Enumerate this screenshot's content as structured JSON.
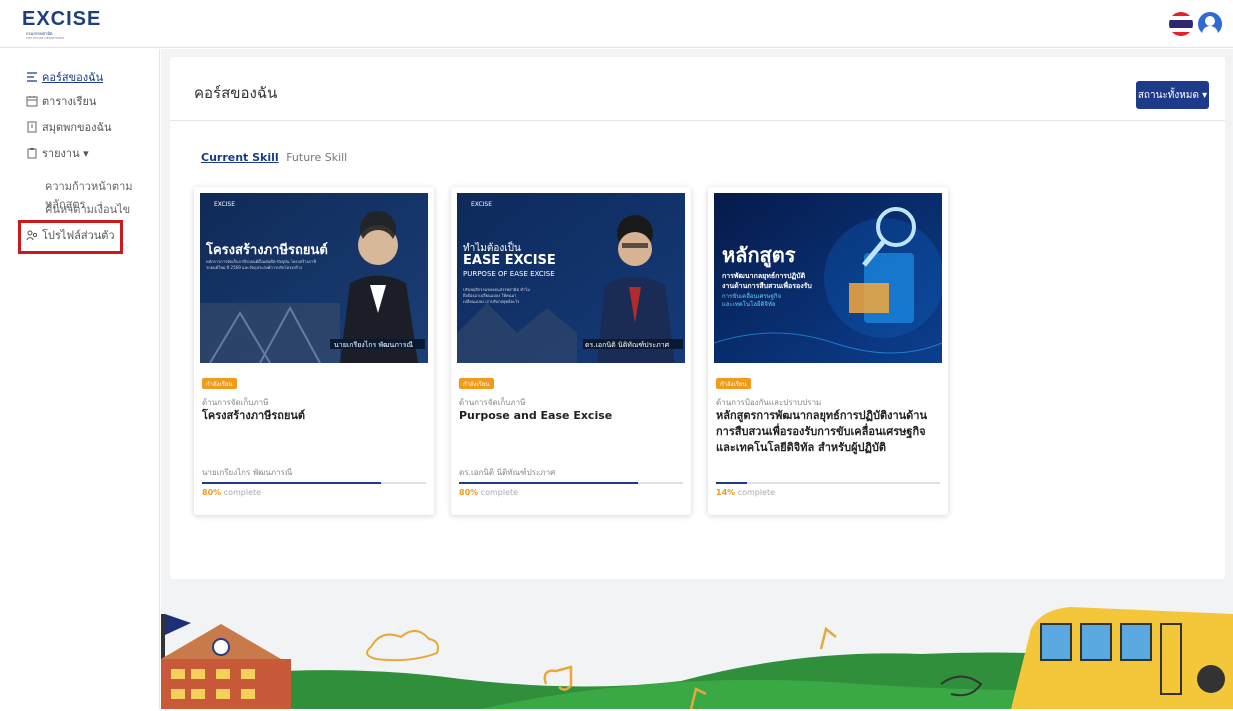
{
  "header": {
    "logo_text": "EXCISE",
    "logo_sub": "กรมสรรพสามิต",
    "logo_sub2": "THE EXCISE DEPARTMENT"
  },
  "sidebar": {
    "items": [
      {
        "label": "คอร์สของฉัน",
        "icon": "list-icon"
      },
      {
        "label": "ตารางเรียน",
        "icon": "calendar-icon"
      },
      {
        "label": "สมุดพกของฉัน",
        "icon": "notebook-icon"
      },
      {
        "label": "รายงาน ▾",
        "icon": "clipboard-icon"
      }
    ],
    "sub_items": [
      "ความก้าวหน้าตามหลักสูตร",
      "ค้นหาตามเงื่อนไข"
    ],
    "profile": {
      "label": "โปรไฟล์ส่วนตัว",
      "icon": "user-group-icon"
    }
  },
  "main": {
    "title": "คอร์สของฉัน",
    "status_button": "สถานะทั้งหมด ▾",
    "tabs": [
      "Current Skill",
      "Future Skill"
    ]
  },
  "cards": [
    {
      "badge": "กำลังเรียน",
      "category": "ด้านการจัดเก็บภาษี",
      "title": "โครงสร้างภาษีรถยนต์",
      "instructor": "นายเกรียงไกร พัฒนภารณี",
      "progress_pct": 80,
      "progress_label": "80%",
      "complete_word": "complete",
      "image": {
        "brand": "EXCISE",
        "headline": "โครงสร้างภาษีรถยนต์",
        "body": "หลักการการจัดเก็บภาษีรถยนต์ตั้งแต่อดีต-ปัจจุบัน โครงสร้างภาษีรถยนต์ใหม่ ปี 2569 และวัตถุประสงค์การปรับโครงสร้าง",
        "speaker": "นายเกรียงไกร พัฒนภารณี"
      }
    },
    {
      "badge": "กำลังเรียน",
      "category": "ด้านการจัดเก็บภาษี",
      "title": "Purpose and Ease Excise",
      "instructor": "ดร.เอกนิติ นิติทัณฑ์ประภาศ",
      "progress_pct": 80,
      "progress_label": "80%",
      "complete_word": "complete",
      "image": {
        "brand": "EXCISE",
        "headline": "ทำไมต้องเป็น",
        "headline2": "EASE EXCISE",
        "headline3": "PURPOSE OF EASE EXCISE",
        "body": "ปรับพฤติกรรมของคนสรรพสามิต ทำไมถึงต้องมาเปลี่ยนแปลง ให้คนมาเปลี่ยนแปลง เราปรับกลยุทธ์อะไร",
        "speaker": "ดร.เอกนิติ นิติทัณฑ์ประภาศ"
      }
    },
    {
      "badge": "กำลังเรียน",
      "category": "ด้านการป้องกันและปราบปราม",
      "title": "หลักสูตรการพัฒนากลยุทธ์การปฏิบัติงานด้านการสืบสวนเพื่อรองรับการขับเคลื่อนเศรษฐกิจและเทคโนโลยีดิจิทัล สำหรับผู้ปฏิบัติ",
      "instructor": "",
      "progress_pct": 14,
      "progress_label": "14%",
      "complete_word": "complete",
      "image": {
        "headline": "หลักสูตร",
        "sub1": "การพัฒนากลยุทธ์การปฏิบัติ",
        "sub2": "งานด้านการสืบสวนเพื่อรองรับ",
        "sub3": "การขับเคลื่อนเศรษฐกิจ",
        "sub4": "และเทคโนโลยีดิจิทัล"
      }
    }
  ],
  "colors": {
    "brand_navy": "#1e3a8a",
    "accent_orange": "#f29a1a",
    "highlight_red": "#cc1a1a"
  }
}
